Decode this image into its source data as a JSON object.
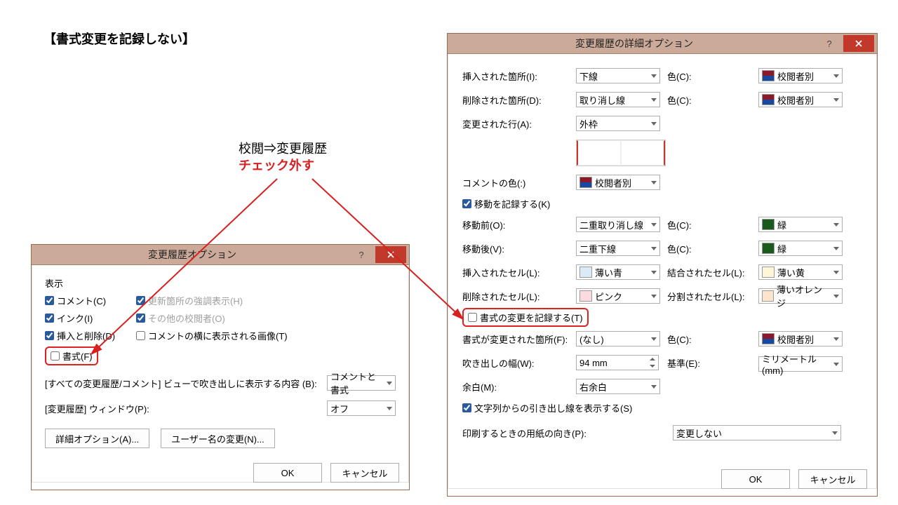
{
  "page_title": "【書式変更を記録しない】",
  "annotation": {
    "line1": "校閲⇒変更履歴",
    "line2": "チェック外す"
  },
  "small_dialog": {
    "title": "変更履歴オプション",
    "section": "表示",
    "checks": {
      "comment": "コメント(C)",
      "ink": "インク(I)",
      "insdel": "挿入と削除(D)",
      "format": "書式(F)",
      "highlight": "更新箇所の強調表示(H)",
      "others": "その他の校閲者(O)",
      "image": "コメントの横に表示される画像(T)"
    },
    "balloon_label": "[すべての変更履歴/コメント] ビューで吹き出しに表示する内容 (B):",
    "balloon_value": "コメントと書式",
    "window_label": "[変更履歴] ウィンドウ(P):",
    "window_value": "オフ",
    "btn_advanced": "詳細オプション(A)...",
    "btn_username": "ユーザー名の変更(N)...",
    "ok": "OK",
    "cancel": "キャンセル"
  },
  "large_dialog": {
    "title": "変更履歴の詳細オプション",
    "rows": {
      "inserted_label": "挿入された箇所(I):",
      "inserted_val": "下線",
      "deleted_label": "削除された箇所(D):",
      "deleted_val": "取り消し線",
      "changed_label": "変更された行(A):",
      "changed_val": "外枠",
      "color_label": "色(C):",
      "byreviewer": "校閲者別",
      "comment_color_label": "コメントの色(:)",
      "track_moves": "移動を記録する(K)",
      "move_from_label": "移動前(O):",
      "move_from_val": "二重取り消し線",
      "move_to_label": "移動後(V):",
      "move_to_val": "二重下線",
      "green": "緑",
      "ins_cell_label": "挿入されたセル(L):",
      "ins_cell_val": "薄い青",
      "merge_cell_label": "結合されたセル(L):",
      "merge_cell_val": "薄い黄",
      "del_cell_label": "削除されたセル(L):",
      "del_cell_val": "ピンク",
      "split_cell_label": "分割されたセル(L):",
      "split_cell_val": "薄いオレンジ",
      "track_format": "書式の変更を記録する(T)",
      "format_loc_label": "書式が変更された箇所(F):",
      "format_loc_val": "(なし)",
      "balloon_w_label": "吹き出しの幅(W):",
      "balloon_w_val": "94 mm",
      "unit_label": "基準(E):",
      "unit_val": "ミリメートル (mm)",
      "margin_label": "余白(M):",
      "margin_val": "右余白",
      "connectors": "文字列からの引き出し線を表示する(S)",
      "orient_label": "印刷するときの用紙の向き(P):",
      "orient_val": "変更しない"
    },
    "ok": "OK",
    "cancel": "キャンセル"
  }
}
